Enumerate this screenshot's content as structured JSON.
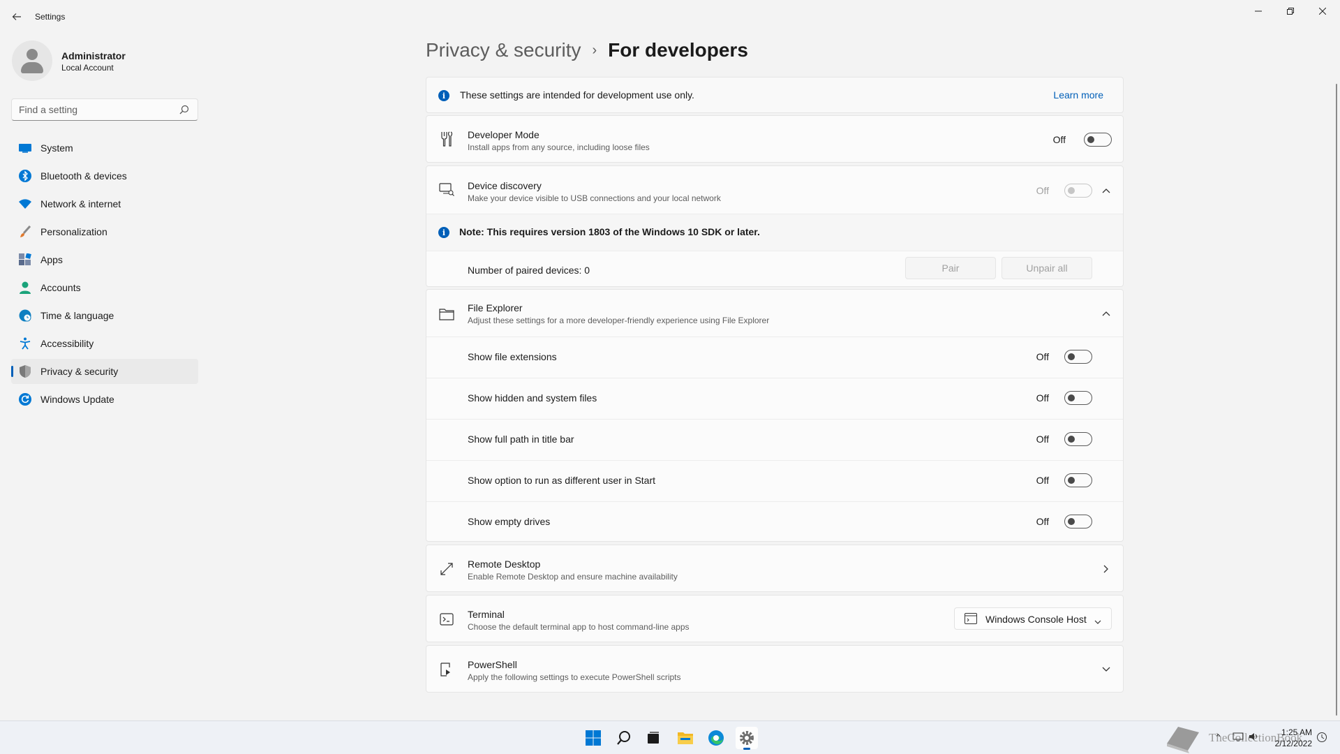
{
  "app": {
    "title": "Settings"
  },
  "profile": {
    "name": "Administrator",
    "account_type": "Local Account"
  },
  "search": {
    "placeholder": "Find a setting"
  },
  "sidebar": {
    "items": [
      {
        "label": "System",
        "icon": "system-icon",
        "color": "#0078d4"
      },
      {
        "label": "Bluetooth & devices",
        "icon": "bluetooth-icon",
        "color": "#0078d4"
      },
      {
        "label": "Network & internet",
        "icon": "wifi-icon",
        "color": "#0078d4"
      },
      {
        "label": "Personalization",
        "icon": "brush-icon",
        "color": "#e07a2f"
      },
      {
        "label": "Apps",
        "icon": "apps-icon",
        "color": "#5a6b8c"
      },
      {
        "label": "Accounts",
        "icon": "person-icon",
        "color": "#1aa37a"
      },
      {
        "label": "Time & language",
        "icon": "globe-clock-icon",
        "color": "#0e7fc1"
      },
      {
        "label": "Accessibility",
        "icon": "accessibility-icon",
        "color": "#0078d4"
      },
      {
        "label": "Privacy & security",
        "icon": "shield-icon",
        "color": "#6b6b6b",
        "active": true
      },
      {
        "label": "Windows Update",
        "icon": "update-icon",
        "color": "#0078d4"
      }
    ]
  },
  "breadcrumb": {
    "parent": "Privacy & security",
    "separator": "›",
    "current": "For developers"
  },
  "info_banner": {
    "text": "These settings are intended for development use only.",
    "link": "Learn more"
  },
  "developer_mode": {
    "title": "Developer Mode",
    "subtitle": "Install apps from any source, including loose files",
    "state": "Off"
  },
  "device_discovery": {
    "title": "Device discovery",
    "subtitle": "Make your device visible to USB connections and your local network",
    "state": "Off",
    "note": "Note: This requires version 1803 of the Windows 10 SDK or later.",
    "paired": "Number of paired devices: 0",
    "pair_label": "Pair",
    "unpair_label": "Unpair all"
  },
  "file_explorer": {
    "title": "File Explorer",
    "subtitle": "Adjust these settings for a more developer-friendly experience using File Explorer",
    "options": [
      {
        "label": "Show file extensions",
        "state": "Off"
      },
      {
        "label": "Show hidden and system files",
        "state": "Off"
      },
      {
        "label": "Show full path in title bar",
        "state": "Off"
      },
      {
        "label": "Show option to run as different user in Start",
        "state": "Off"
      },
      {
        "label": "Show empty drives",
        "state": "Off"
      }
    ]
  },
  "remote_desktop": {
    "title": "Remote Desktop",
    "subtitle": "Enable Remote Desktop and ensure machine availability"
  },
  "terminal": {
    "title": "Terminal",
    "subtitle": "Choose the default terminal app to host command-line apps",
    "selected": "Windows Console Host"
  },
  "powershell": {
    "title": "PowerShell",
    "subtitle": "Apply the following settings to execute PowerShell scripts"
  },
  "taskbar": {
    "time": "1:25 AM",
    "date": "2/12/2022",
    "watermark": "TheCollectionBook"
  },
  "colors": {
    "accent": "#005fb8",
    "info": "#005fb8"
  }
}
